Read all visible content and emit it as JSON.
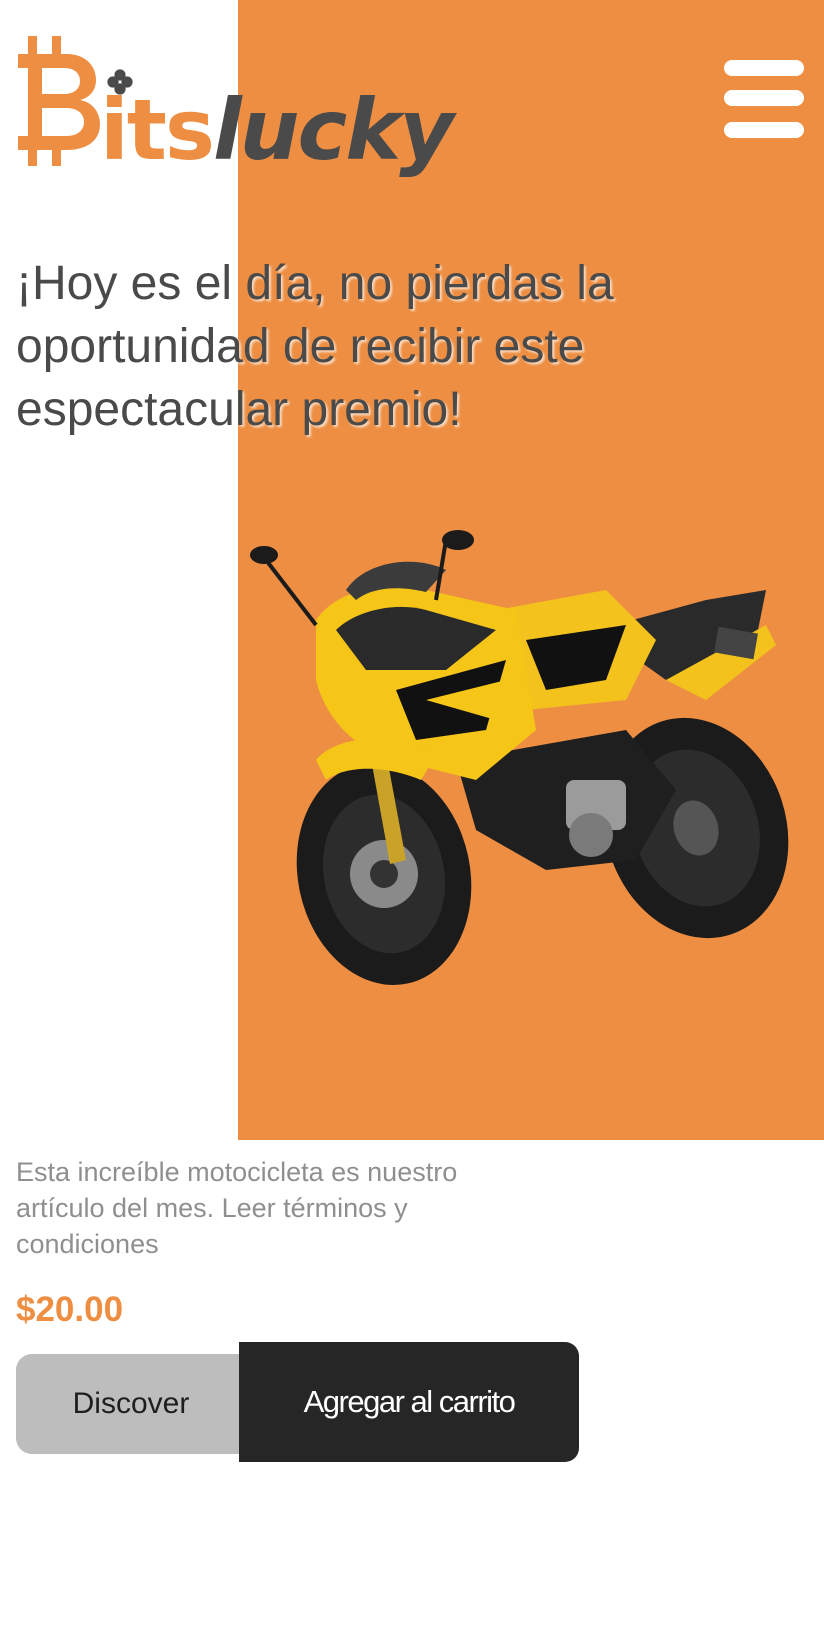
{
  "brand": {
    "logo_text_highlight": "its",
    "logo_text_rest": "lucky",
    "logo_icon": "bitcoin-b-icon"
  },
  "header": {
    "menu_icon": "hamburger-menu-icon"
  },
  "hero": {
    "headline": "¡Hoy es el día, no pierdas la oportunidad de recibir este espectacular premio!",
    "image": "yellow-sport-motorcycle"
  },
  "product": {
    "description": "Esta increíble motocicleta es nuestro artículo del mes. Leer términos y condiciones",
    "price": "$20.00"
  },
  "actions": {
    "discover_label": "Discover",
    "cart_label": "Agregar al carrito"
  },
  "colors": {
    "accent": "#ED8E42",
    "dark_text": "#4a4a4a",
    "muted_text": "#8f8f8f",
    "button_dark": "#262626",
    "button_light": "#bdbdbd"
  }
}
